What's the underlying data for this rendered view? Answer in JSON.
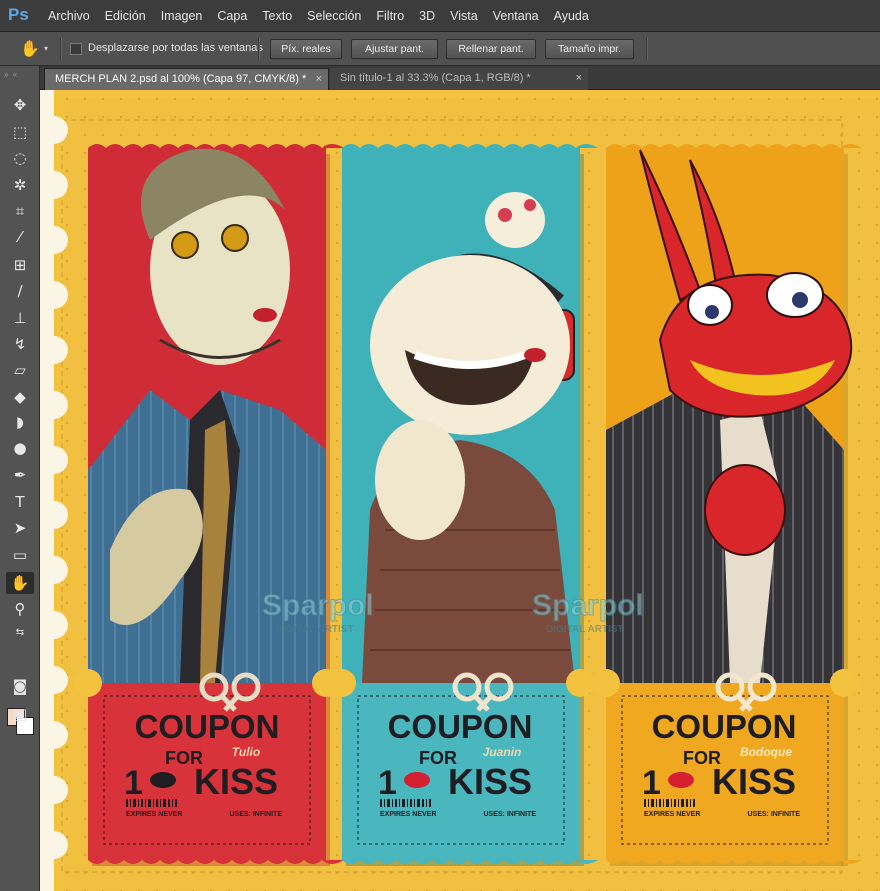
{
  "app": {
    "logo": "Ps"
  },
  "menu": [
    "Archivo",
    "Edición",
    "Imagen",
    "Capa",
    "Texto",
    "Selección",
    "Filtro",
    "3D",
    "Vista",
    "Ventana",
    "Ayuda"
  ],
  "options": {
    "tool_icon": "hand-icon",
    "scroll_all_label": "Desplazarse por todas las ventanas",
    "buttons": [
      "Píx. reales",
      "Ajustar pant.",
      "Rellenar pant.",
      "Tamaño impr."
    ]
  },
  "tabs": [
    {
      "title": "MERCH PLAN 2.psd al 100% (Capa 97, CMYK/8) *",
      "close": "×"
    },
    {
      "title": "Sin título-1 al 33.3% (Capa 1, RGB/8) *",
      "close": "×"
    }
  ],
  "tools": [
    "move-icon",
    "marquee-icon",
    "lasso-icon",
    "magic-wand-icon",
    "crop-icon",
    "eyedropper-icon",
    "healing-icon",
    "brush-icon",
    "stamp-icon",
    "history-brush-icon",
    "eraser-icon",
    "paint-bucket-icon",
    "blur-icon",
    "dodge-icon",
    "pen-icon",
    "type-icon",
    "path-select-icon",
    "shape-icon",
    "hand-icon",
    "zoom-icon",
    "quick-mask-icon",
    "screen-mode-icon"
  ],
  "colors": {
    "foreground": "#f7d9c5",
    "background": "#ffffff",
    "canvas_bg": "#f2c040",
    "coupon_red": "#d8323a",
    "coupon_teal": "#4ab6bd",
    "coupon_orange": "#efa81f"
  },
  "coupons": [
    {
      "headline": "COUPON",
      "for": "FOR",
      "name": "Tulio",
      "count": "1",
      "kiss": "KISS",
      "expires": "EXPIRES NEVER",
      "uses": "USES: INFINITE",
      "bg": "#d8323a",
      "art_bg": "#cf2c38"
    },
    {
      "headline": "COUPON",
      "for": "FOR",
      "name": "Juanin",
      "count": "1",
      "kiss": "KISS",
      "expires": "EXPIRES NEVER",
      "uses": "USES: INFINITE",
      "bg": "#4ab6bd",
      "art_bg": "#3fb1b8"
    },
    {
      "headline": "COUPON",
      "for": "FOR",
      "name": "Bodoque",
      "count": "1",
      "kiss": "KISS",
      "expires": "EXPIRES NEVER",
      "uses": "USES: INFINITE",
      "bg": "#efa81f",
      "art_bg": "#eea21a"
    }
  ],
  "watermark": {
    "name": "Sparpol",
    "sub": "DIGITAL ARTIST"
  }
}
